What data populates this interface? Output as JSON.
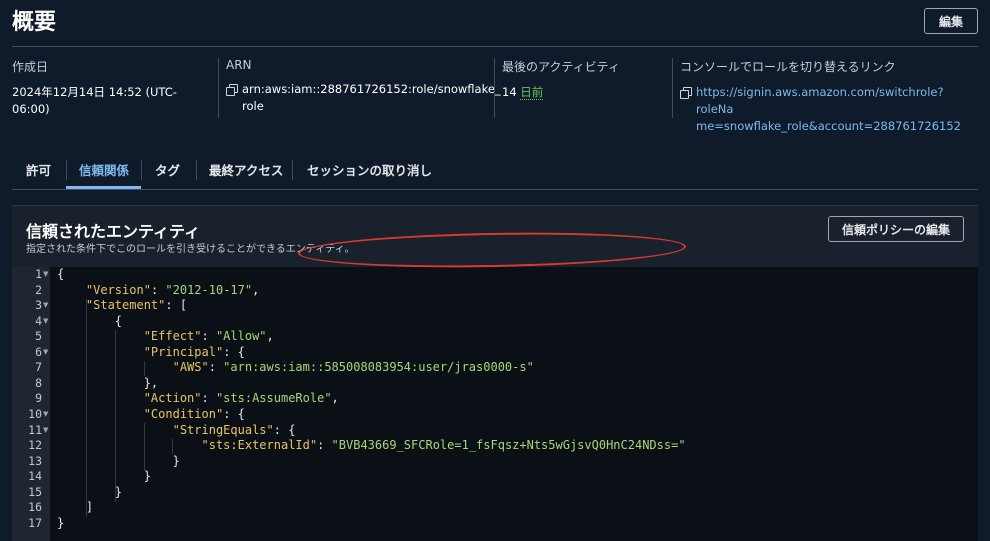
{
  "header": {
    "title": "概要",
    "edit_label": "編集"
  },
  "summary": {
    "created_label": "作成日",
    "created_value": "2024年12月14日 14:52 (UTC-06:00)",
    "arn_label": "ARN",
    "arn_value_line1": "arn:aws:iam::288761726152:role/snowflake_",
    "arn_value_line2": "role",
    "last_activity_label": "最後のアクティビティ",
    "last_activity_prefix": "14",
    "last_activity_value": "日前",
    "switch_link_label": "コンソールでロールを切り替えるリンク",
    "switch_link_line1": "https://signin.aws.amazon.com/switchrole?roleNa",
    "switch_link_line2": "me=snowflake_role&account=288761726152"
  },
  "tabs": [
    {
      "label": "許可"
    },
    {
      "label": "信頼関係",
      "active": true
    },
    {
      "label": "タグ"
    },
    {
      "label": "最終アクセス"
    },
    {
      "label": "セッションの取り消し"
    }
  ],
  "panel": {
    "title": "信頼されたエンティティ",
    "description": "指定された条件下でこのロールを引き受けることができるエンティティ。",
    "edit_policy_label": "信頼ポリシーの編集"
  },
  "code": {
    "line_numbers": [
      "1",
      "2",
      "3",
      "4",
      "5",
      "6",
      "7",
      "8",
      "9",
      "10",
      "11",
      "12",
      "13",
      "14",
      "15",
      "16",
      "17"
    ],
    "lines": [
      "{",
      "    \"Version\": \"2012-10-17\",",
      "    \"Statement\": [",
      "        {",
      "            \"Effect\": \"Allow\",",
      "            \"Principal\": {",
      "                \"AWS\": \"arn:aws:iam::585008083954:user/jras0000-s\"",
      "            },",
      "            \"Action\": \"sts:AssumeRole\",",
      "            \"Condition\": {",
      "                \"StringEquals\": {",
      "                    \"sts:ExternalId\": \"BVB43669_SFCRole=1_fsFqsz+Nts5wGjsvQ0HnC24NDss=\"",
      "                }",
      "            }",
      "        }",
      "    ]",
      "}"
    ],
    "foldable_lines": [
      1,
      3,
      4,
      6,
      10,
      11
    ]
  },
  "colors": {
    "background": "#0f1b2a",
    "panel": "#19212c",
    "editor": "#0b1017",
    "accent_link": "#7fb9f0",
    "json_key": "#e8c36a",
    "json_string": "#a8d67a",
    "highlight_annotation": "#d83a2e"
  }
}
